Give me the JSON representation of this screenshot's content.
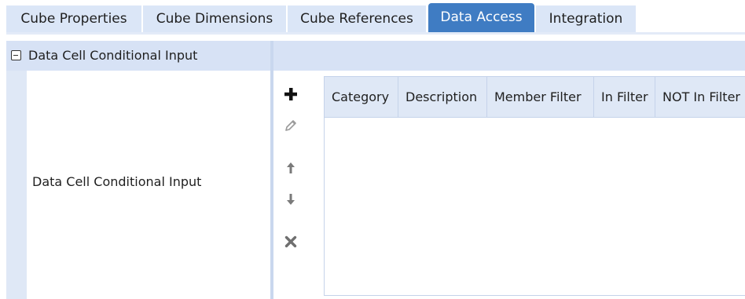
{
  "tabs": [
    {
      "label": "Cube Properties",
      "active": false
    },
    {
      "label": "Cube Dimensions",
      "active": false
    },
    {
      "label": "Cube References",
      "active": false
    },
    {
      "label": "Data Access",
      "active": true
    },
    {
      "label": "Integration",
      "active": false
    }
  ],
  "section": {
    "title": "Data Cell Conditional Input",
    "expanded": true,
    "row_label": "Data Cell Conditional Input"
  },
  "toolbar": {
    "add": "add-icon",
    "edit": "pencil-icon",
    "move_up": "arrow-up-icon",
    "move_down": "arrow-down-icon",
    "delete": "delete-icon"
  },
  "grid": {
    "columns": [
      "Category",
      "Description",
      "Member Filter",
      "In Filter",
      "NOT In Filter"
    ],
    "rows": []
  },
  "colors": {
    "active_tab": "#3f7cc3",
    "tab": "#dbe6f7",
    "header": "#d7e2f5"
  }
}
